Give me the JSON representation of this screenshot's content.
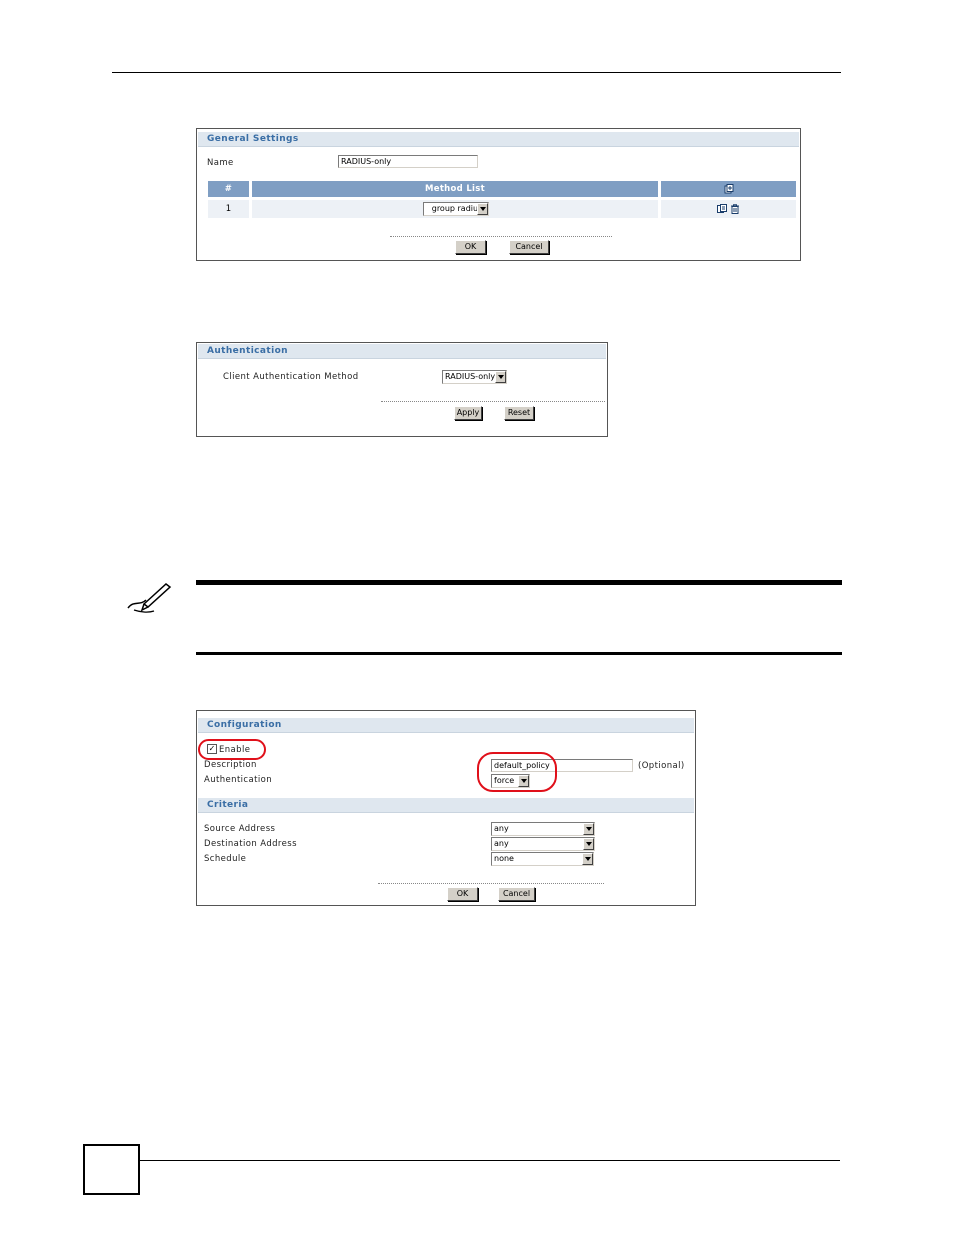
{
  "general_settings": {
    "title": "General Settings",
    "name_label": "Name",
    "name_value": "RADIUS-only",
    "table": {
      "columns": [
        "#",
        "Method List"
      ],
      "rows": [
        {
          "index": "1",
          "method": "group radius"
        }
      ]
    },
    "ok_label": "OK",
    "cancel_label": "Cancel"
  },
  "authentication": {
    "title": "Authentication",
    "method_label": "Client Authentication Method",
    "method_value": "RADIUS-only",
    "apply_label": "Apply",
    "reset_label": "Reset"
  },
  "configuration": {
    "title": "Configuration",
    "enable_label": "Enable",
    "enable_checked": true,
    "description_label": "Description",
    "description_value": "default_policy",
    "optional_label": "(Optional)",
    "authentication_label": "Authentication",
    "authentication_value": "force",
    "criteria_title": "Criteria",
    "source_label": "Source Address",
    "source_value": "any",
    "destination_label": "Destination Address",
    "destination_value": "any",
    "schedule_label": "Schedule",
    "schedule_value": "none",
    "ok_label": "OK",
    "cancel_label": "Cancel"
  },
  "colors": {
    "header_text": "#3a6ea5",
    "table_header": "#7f9ec3",
    "highlight": "#e0101a"
  },
  "icons": {
    "table_add": "add-icon",
    "row_edit": "edit-icon",
    "row_delete": "trash-icon",
    "note": "pen-note-icon"
  }
}
